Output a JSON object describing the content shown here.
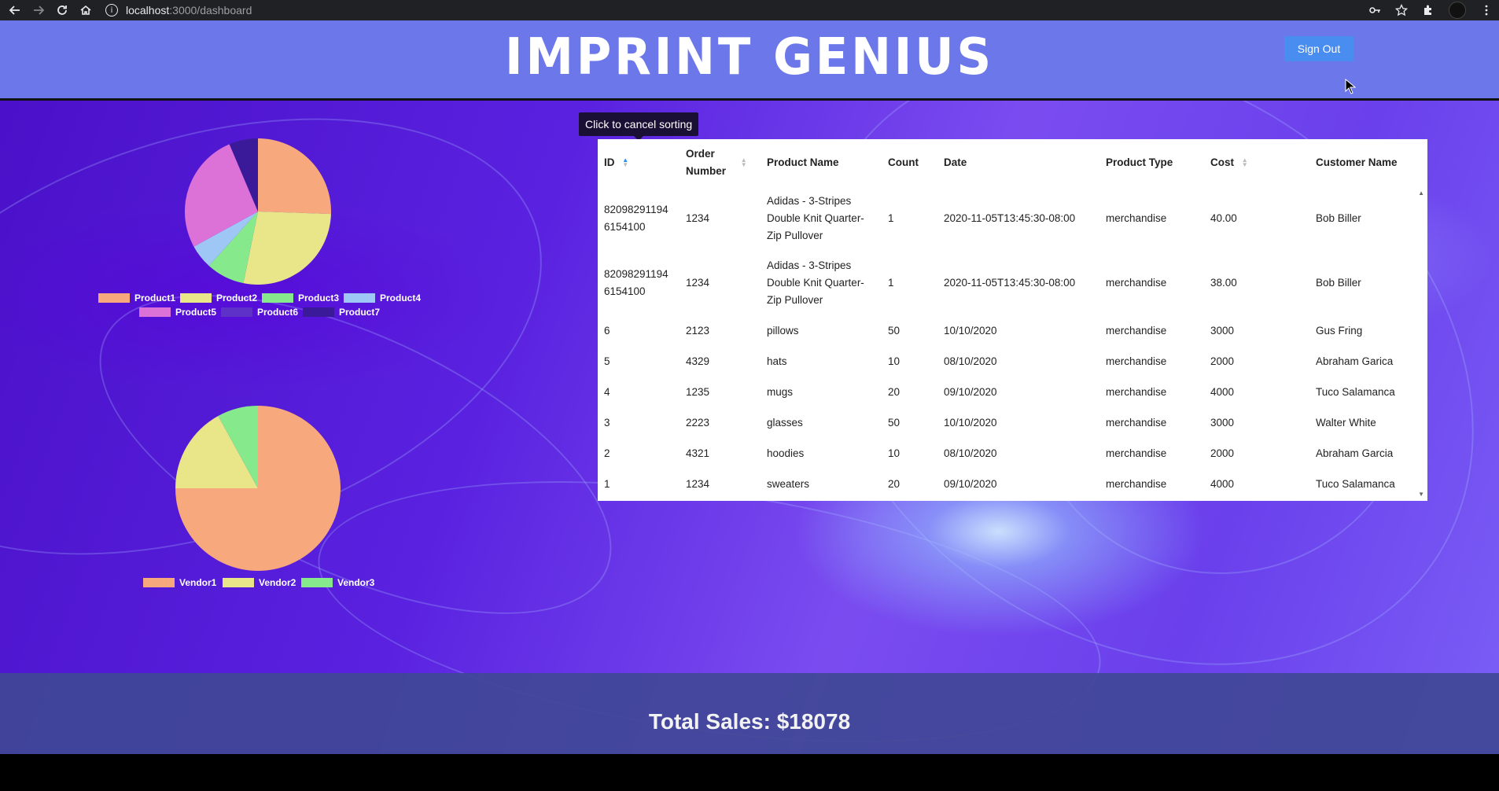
{
  "browser": {
    "url_host": "localhost",
    "url_path": ":3000/dashboard"
  },
  "header": {
    "brand": "IMPRINT GENIUS",
    "signout_label": "Sign Out"
  },
  "tooltip": "Click to cancel sorting",
  "chart_data": [
    {
      "type": "pie",
      "labels": [
        "Product1",
        "Product2",
        "Product3",
        "Product4",
        "Product5",
        "Product6",
        "Product7"
      ],
      "values": [
        24,
        26,
        8,
        5,
        25,
        0,
        6
      ],
      "colors": [
        "#f7a87c",
        "#e9e68a",
        "#86ea8c",
        "#9fc7f5",
        "#dc72d8",
        "#5e32c9",
        "#3b1a9a"
      ]
    },
    {
      "type": "pie",
      "labels": [
        "Vendor1",
        "Vendor2",
        "Vendor3"
      ],
      "values": [
        75,
        17,
        8
      ],
      "colors": [
        "#f7a87c",
        "#e9e68a",
        "#86ea8c"
      ]
    }
  ],
  "table": {
    "columns": [
      "ID",
      "Order Number",
      "Product Name",
      "Count",
      "Date",
      "Product Type",
      "Cost",
      "Customer Name"
    ],
    "rows": [
      [
        "82098291194 6154100",
        "1234",
        "Adidas - 3-Stripes Double Knit Quarter-Zip Pullover",
        "1",
        "2020-11-05T13:45:30-08:00",
        "merchandise",
        "40.00",
        "Bob Biller"
      ],
      [
        "82098291194 6154100",
        "1234",
        "Adidas - 3-Stripes Double Knit Quarter-Zip Pullover",
        "1",
        "2020-11-05T13:45:30-08:00",
        "merchandise",
        "38.00",
        "Bob Biller"
      ],
      [
        "6",
        "2123",
        "pillows",
        "50",
        "10/10/2020",
        "merchandise",
        "3000",
        "Gus Fring"
      ],
      [
        "5",
        "4329",
        "hats",
        "10",
        "08/10/2020",
        "merchandise",
        "2000",
        "Abraham Garica"
      ],
      [
        "4",
        "1235",
        "mugs",
        "20",
        "09/10/2020",
        "merchandise",
        "4000",
        "Tuco Salamanca"
      ],
      [
        "3",
        "2223",
        "glasses",
        "50",
        "10/10/2020",
        "merchandise",
        "3000",
        "Walter White"
      ],
      [
        "2",
        "4321",
        "hoodies",
        "10",
        "08/10/2020",
        "merchandise",
        "2000",
        "Abraham Garcia"
      ],
      [
        "1",
        "1234",
        "sweaters",
        "20",
        "09/10/2020",
        "merchandise",
        "4000",
        "Tuco Salamanca"
      ]
    ]
  },
  "footer": {
    "total_sales": "Total Sales: $18078"
  }
}
